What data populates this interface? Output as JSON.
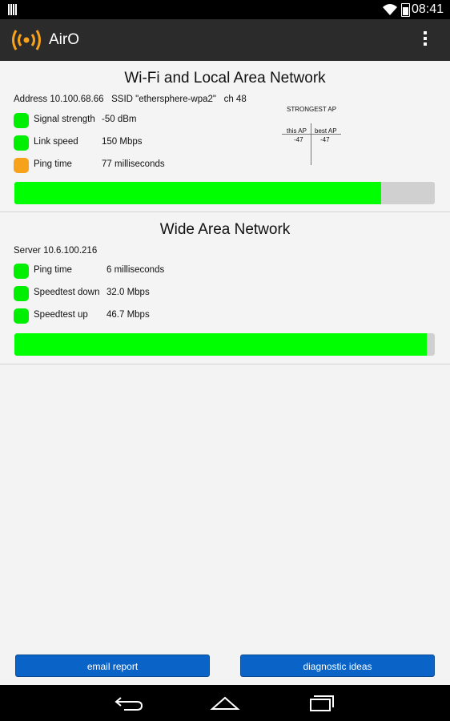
{
  "status_bar": {
    "time": "08:41"
  },
  "app": {
    "title": "AirO"
  },
  "lan": {
    "title": "Wi-Fi and Local Area Network",
    "address_line": "Address 10.100.68.66   SSID \"ethersphere-wpa2\"   ch 48",
    "rows": [
      {
        "label": "Signal strength",
        "value": "-50 dBm",
        "color": "#00ee00"
      },
      {
        "label": "Link speed",
        "value": "150 Mbps",
        "color": "#00ee00"
      },
      {
        "label": "Ping time",
        "value": "77 milliseconds",
        "color": "#f7a21b"
      }
    ],
    "strongest_ap": {
      "title": "STRONGEST AP",
      "this_ap_label": "this AP",
      "best_ap_label": "best AP",
      "this_ap_value": "-47",
      "best_ap_value": "-47"
    },
    "score_fraction": 0.873
  },
  "wan": {
    "title": "Wide Area Network",
    "server_line": "Server 10.6.100.216",
    "rows": [
      {
        "label": "Ping time",
        "value": "6 milliseconds",
        "color": "#00ee00"
      },
      {
        "label": "Speedtest down",
        "value": "32.0 Mbps",
        "color": "#00ee00"
      },
      {
        "label": "Speedtest up",
        "value": "46.7 Mbps",
        "color": "#00ee00"
      }
    ],
    "score_fraction": 0.981
  },
  "buttons": {
    "email": "email report",
    "diagnostic": "diagnostic ideas"
  },
  "colors": {
    "good": "#00ff00",
    "warn": "#f7a21b",
    "button": "#0a64c8",
    "appbar": "#2b2b2b"
  }
}
